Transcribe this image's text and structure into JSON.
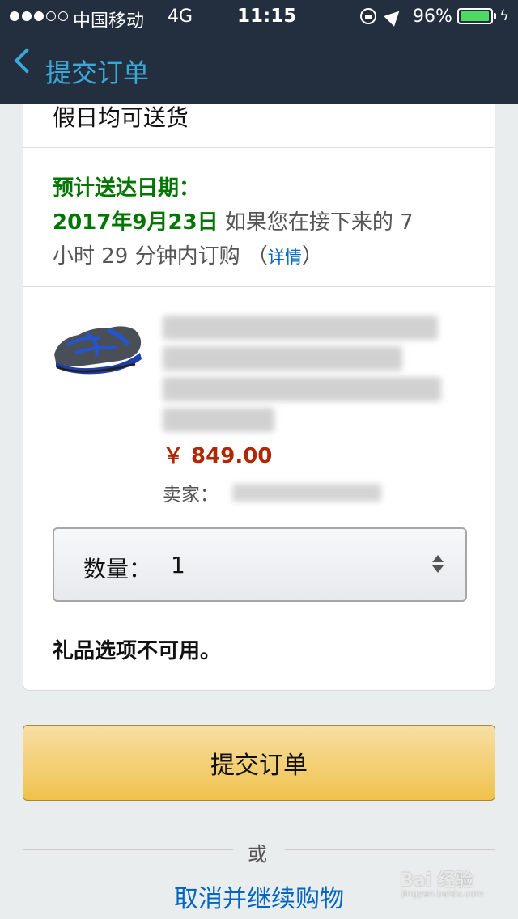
{
  "status_bar": {
    "carrier": "中国移动",
    "network": "4G",
    "time": "11:15",
    "battery": "96%",
    "battery_level": 0.96
  },
  "nav": {
    "title": "提交订单"
  },
  "delivery": {
    "prev_row_text": "假日均可送货",
    "eta_label": "预计送达日期：",
    "eta_date": "2017年9月23日",
    "eta_text_a": " 如果您在接下来的 7",
    "eta_text_b": "小时 29 分钟内订购 （",
    "detail_link": "详情",
    "eta_text_c": "）"
  },
  "product": {
    "price": "￥ 849.00",
    "seller_label": "卖家："
  },
  "quantity": {
    "label": "数量：",
    "value": "1"
  },
  "gift": {
    "text": "礼品选项不可用。"
  },
  "actions": {
    "submit_label": "提交订单",
    "or_text": "或",
    "cancel_label": "取消并继续购物"
  },
  "watermark": {
    "text": "Bai 经验",
    "sub": "jingyan.baidu.com"
  }
}
